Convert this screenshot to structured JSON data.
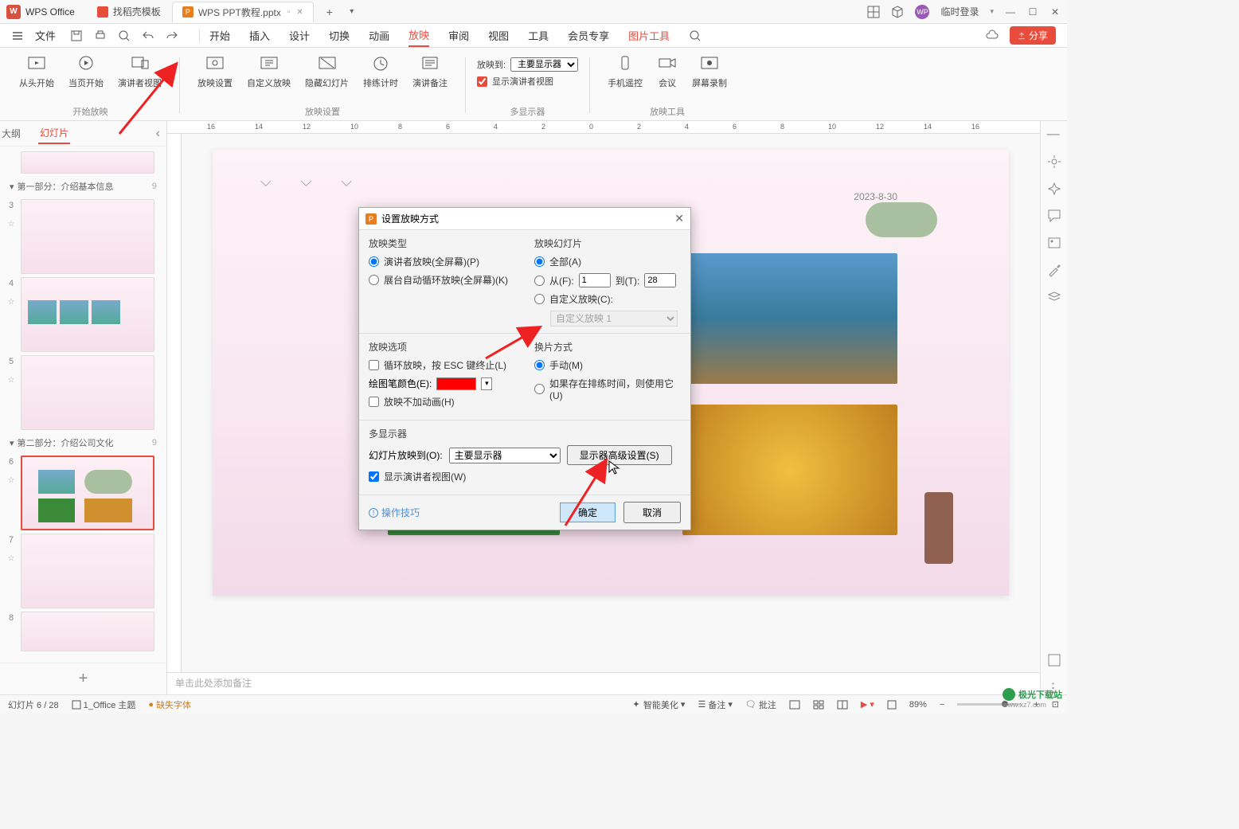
{
  "titlebar": {
    "app_name": "WPS Office",
    "tabs": [
      {
        "label": "找稻壳模板"
      },
      {
        "label": "WPS PPT教程.pptx"
      }
    ],
    "login_text": "临时登录"
  },
  "menubar": {
    "file": "文件",
    "items": [
      "开始",
      "插入",
      "设计",
      "切换",
      "动画",
      "放映",
      "审阅",
      "视图",
      "工具",
      "会员专享",
      "图片工具"
    ],
    "active": "放映",
    "share": "分享"
  },
  "ribbon": {
    "groups": [
      {
        "name": "开始放映",
        "buttons": [
          {
            "label": "从头开始",
            "icon": "play-from-start-icon"
          },
          {
            "label": "当页开始",
            "icon": "play-from-current-icon"
          },
          {
            "label": "演讲者视图",
            "icon": "presenter-view-icon"
          }
        ]
      },
      {
        "name": "放映设置",
        "buttons": [
          {
            "label": "放映设置",
            "icon": "slideshow-settings-icon"
          },
          {
            "label": "自定义放映",
            "icon": "custom-show-icon"
          },
          {
            "label": "隐藏幻灯片",
            "icon": "hide-slide-icon"
          },
          {
            "label": "排练计时",
            "icon": "rehearse-icon"
          },
          {
            "label": "演讲备注",
            "icon": "speaker-notes-icon"
          }
        ]
      },
      {
        "name": "多显示器",
        "row1_label": "放映到:",
        "row1_value": "主要显示器",
        "row2_label": "显示演讲者视图",
        "row2_checked": true
      },
      {
        "name": "放映工具",
        "buttons": [
          {
            "label": "手机遥控",
            "icon": "phone-remote-icon"
          },
          {
            "label": "会议",
            "icon": "meeting-icon"
          },
          {
            "label": "屏幕录制",
            "icon": "screen-record-icon"
          }
        ]
      }
    ]
  },
  "sidepanel": {
    "tabs": [
      "大纲",
      "幻灯片"
    ],
    "active": "幻灯片",
    "sections": [
      {
        "label": "第一部分：介绍基本信息",
        "count": 9
      },
      {
        "label": "第二部分：介绍公司文化",
        "count": 9
      }
    ],
    "thumbs_visible": [
      "3",
      "4",
      "5",
      "6",
      "7",
      "8"
    ],
    "selected": "6"
  },
  "canvas": {
    "date": "2023-8-30",
    "notes_placeholder": "单击此处添加备注"
  },
  "ruler_ticks": [
    "16",
    "14",
    "12",
    "10",
    "8",
    "6",
    "4",
    "2",
    "0",
    "2",
    "4",
    "6",
    "8",
    "10",
    "12",
    "14",
    "16"
  ],
  "dialog": {
    "title": "设置放映方式",
    "type_header": "放映类型",
    "type_opt1": "演讲者放映(全屏幕)(P)",
    "type_opt2": "展台自动循环放映(全屏幕)(K)",
    "slides_header": "放映幻灯片",
    "slides_all": "全部(A)",
    "slides_from": "从(F):",
    "slides_from_val": "1",
    "slides_to": "到(T):",
    "slides_to_val": "28",
    "slides_custom": "自定义放映(C):",
    "slides_custom_val": "自定义放映 1",
    "opts_header": "放映选项",
    "opts_loop": "循环放映，按 ESC 键终止(L)",
    "opts_pen": "绘图笔颜色(E):",
    "opts_pen_color": "#ff0000",
    "opts_noanim": "放映不加动画(H)",
    "advance_header": "换片方式",
    "advance_manual": "手动(M)",
    "advance_timings": "如果存在排练时间，则使用它(U)",
    "multi_header": "多显示器",
    "multi_to": "幻灯片放映到(O):",
    "multi_to_val": "主要显示器",
    "multi_adv": "显示器高级设置(S)",
    "multi_presenter": "显示演讲者视图(W)",
    "tips": "操作技巧",
    "ok": "确定",
    "cancel": "取消"
  },
  "statusbar": {
    "slide_pos": "幻灯片 6 / 28",
    "theme": "1_Office 主题",
    "missing_font": "缺失字体",
    "beautify": "智能美化",
    "notes": "备注",
    "comment": "批注",
    "zoom": "89%"
  },
  "watermark": {
    "brand": "极光下载站",
    "url": "www.xz7.com"
  }
}
